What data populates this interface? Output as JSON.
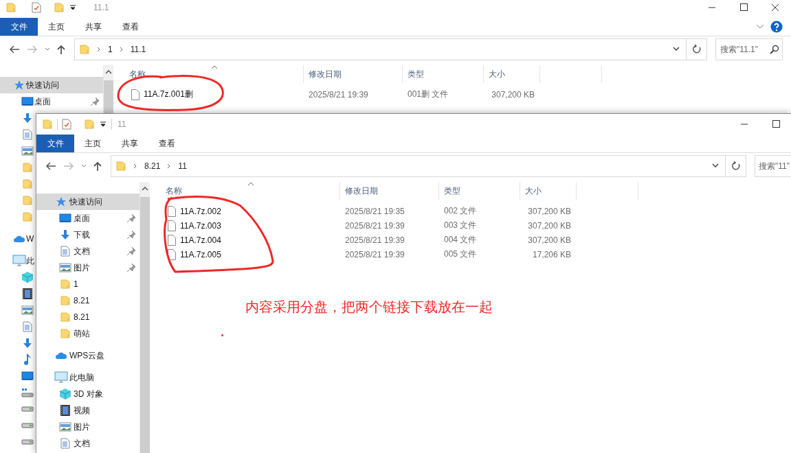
{
  "back_window": {
    "title": "11.1",
    "title_buttons": [
      {
        "kind": "minimize"
      },
      {
        "kind": "maximize"
      },
      {
        "kind": "close"
      }
    ],
    "ribbon_buttons": [
      {
        "kind": "collapse"
      },
      {
        "kind": "help"
      }
    ],
    "ribbon_tabs": [
      {
        "label": "文件",
        "kind": "file"
      },
      {
        "label": "主页",
        "kind": "tab"
      },
      {
        "label": "共享",
        "kind": "tab"
      },
      {
        "label": "查看",
        "kind": "tab"
      }
    ],
    "breadcrumb": [
      "1",
      "11.1"
    ],
    "search": {
      "placeholder": "搜索\"11.1\""
    },
    "sidebar": [
      {
        "label": "快速访问",
        "kind": "star",
        "selected": true,
        "children": [
          {
            "label": "桌面",
            "kind": "desktop",
            "pinned": true,
            "selected": false
          },
          {
            "kind": "download",
            "selected": false
          },
          {
            "kind": "document",
            "selected": false
          },
          {
            "kind": "picture",
            "selected": false
          },
          {
            "kind": "folder",
            "selected": false
          },
          {
            "kind": "folder",
            "selected": false
          },
          {
            "kind": "folder",
            "selected": false
          },
          {
            "kind": "folder",
            "selected": false
          }
        ]
      },
      {
        "label": "W",
        "kind": "cloud",
        "selected": false
      },
      {
        "label": "此",
        "kind": "pc",
        "selected": false,
        "children": [
          {
            "kind": "cube",
            "selected": false
          },
          {
            "kind": "video",
            "selected": false
          },
          {
            "kind": "picture",
            "selected": false
          },
          {
            "kind": "document",
            "selected": false
          },
          {
            "kind": "download",
            "selected": false
          },
          {
            "kind": "music",
            "selected": false
          },
          {
            "kind": "desktop",
            "selected": false
          },
          {
            "kind": "netdrive",
            "selected": false
          },
          {
            "kind": "drive",
            "selected": false
          },
          {
            "kind": "drive",
            "selected": false
          },
          {
            "kind": "drive",
            "selected": false
          }
        ]
      }
    ],
    "columns": [
      "名称",
      "修改日期",
      "类型",
      "大小"
    ],
    "files": [
      {
        "name": "11A.7z.001删",
        "modified": "2025/8/21 19:39",
        "type": "001删 文件",
        "size": "307,200 KB"
      }
    ]
  },
  "front_window": {
    "title": "11",
    "title_buttons": [
      {
        "kind": "minimize"
      },
      {
        "kind": "maximize"
      }
    ],
    "ribbon_tabs": [
      {
        "label": "文件",
        "kind": "file"
      },
      {
        "label": "主页",
        "kind": "tab"
      },
      {
        "label": "共享",
        "kind": "tab"
      },
      {
        "label": "查看",
        "kind": "tab"
      }
    ],
    "breadcrumb": [
      "8.21",
      "11"
    ],
    "search": {
      "placeholder": "搜索\"11\""
    },
    "sidebar": [
      {
        "label": "快速访问",
        "kind": "star",
        "selected": true,
        "children": [
          {
            "label": "桌面",
            "kind": "desktop",
            "pinned": true,
            "selected": false
          },
          {
            "label": "下载",
            "kind": "download",
            "pinned": true,
            "selected": false
          },
          {
            "label": "文档",
            "kind": "document",
            "pinned": true,
            "selected": false
          },
          {
            "label": "图片",
            "kind": "picture",
            "pinned": true,
            "selected": false
          },
          {
            "label": "1",
            "kind": "folder",
            "pinned": false,
            "selected": false
          },
          {
            "label": "8.21",
            "kind": "folder",
            "pinned": false,
            "selected": false
          },
          {
            "label": "8.21",
            "kind": "folder",
            "pinned": false,
            "selected": false
          },
          {
            "label": "萌站",
            "kind": "folder",
            "pinned": false,
            "selected": false
          }
        ]
      },
      {
        "label": "WPS云盘",
        "kind": "cloud",
        "selected": false
      },
      {
        "label": "此电脑",
        "kind": "pc",
        "selected": false,
        "children": [
          {
            "label": "3D 对象",
            "kind": "cube",
            "selected": false
          },
          {
            "label": "视频",
            "kind": "video",
            "selected": false
          },
          {
            "label": "图片",
            "kind": "picture",
            "selected": false
          },
          {
            "label": "文档",
            "kind": "document",
            "selected": false
          }
        ]
      }
    ],
    "columns": [
      "名称",
      "修改日期",
      "类型",
      "大小"
    ],
    "files": [
      {
        "name": "11A.7z.002",
        "modified": "2025/8/21 19:35",
        "type": "002 文件",
        "size": "307,200 KB"
      },
      {
        "name": "11A.7z.003",
        "modified": "2025/8/21 19:39",
        "type": "003 文件",
        "size": "307,200 KB"
      },
      {
        "name": "11A.7z.004",
        "modified": "2025/8/21 19:39",
        "type": "004 文件",
        "size": "307,200 KB"
      },
      {
        "name": "11A.7z.005",
        "modified": "2025/8/21 19:39",
        "type": "005 文件",
        "size": "17,206 KB"
      }
    ]
  },
  "annotation": {
    "note": "内容采用分盘，把两个链接下载放在一起"
  }
}
